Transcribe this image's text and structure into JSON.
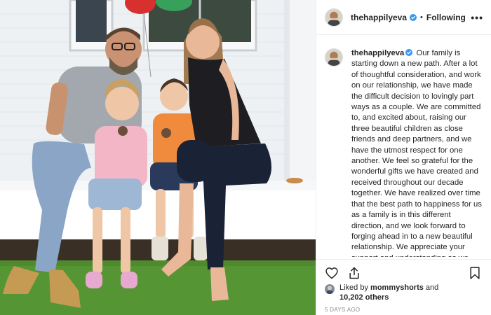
{
  "post": {
    "username": "thehappilyeva",
    "follow_status": "Following",
    "separator": "•",
    "more_label": "•••",
    "caption": "Our family is starting down a new path. After a lot of thoughtful consideration, and work on our relationship, we have made the difficult decision to lovingly part ways as a couple. We are committed to, and excited about, raising our three beautiful children as close friends and deep partners, and we have the utmost respect for one another. We feel so grateful for the wonderful gifts we have created and received throughout our decade together. We have realized over time that the best path to happiness for us as a family is in this different direction, and we look forward to forging ahead in to a new beautiful relationship. We appreciate your support and understanding as we navigate this new transition for our family. All the love, Eva & Kyle",
    "likes": {
      "prefix": "Liked by",
      "liker": "mommyshorts",
      "conjunction": "and",
      "count": "10,202 others"
    },
    "timestamp": "5 DAYS AGO"
  },
  "icons": {
    "verified": "verified-badge-icon",
    "like": "heart-icon",
    "share": "share-icon",
    "save": "bookmark-icon"
  },
  "colors": {
    "verified_blue": "#3897f0",
    "text": "#262626",
    "muted": "#8e8e8e",
    "border": "#efefef"
  }
}
